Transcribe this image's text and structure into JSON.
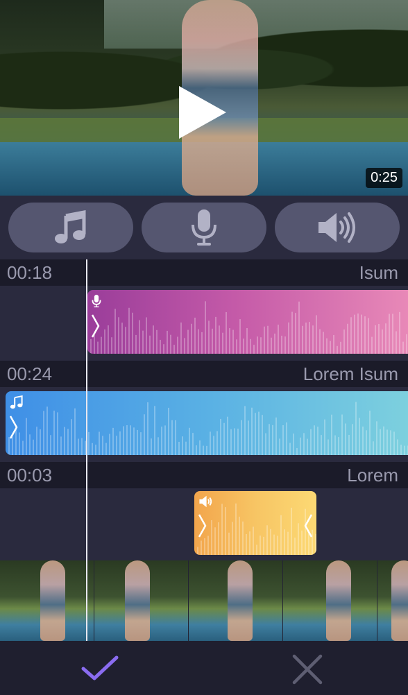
{
  "video": {
    "duration": "0:25"
  },
  "buttons": [
    {
      "icon": "music-note-icon"
    },
    {
      "icon": "microphone-icon"
    },
    {
      "icon": "speaker-icon"
    }
  ],
  "tracks": [
    {
      "time": "00:18",
      "name": "Isum",
      "type": "voice",
      "icon": "microphone-icon"
    },
    {
      "time": "00:24",
      "name": "Lorem Isum",
      "type": "music",
      "icon": "music-note-icon"
    },
    {
      "time": "00:03",
      "name": "Lorem",
      "type": "sound",
      "icon": "speaker-icon"
    }
  ],
  "footer": {
    "confirm_icon": "checkmark-icon",
    "cancel_icon": "close-icon"
  },
  "colors": {
    "accent": "#8a6cf0",
    "voice": "#c45aa8",
    "music": "#4fa3e6",
    "sound": "#f7c564"
  }
}
